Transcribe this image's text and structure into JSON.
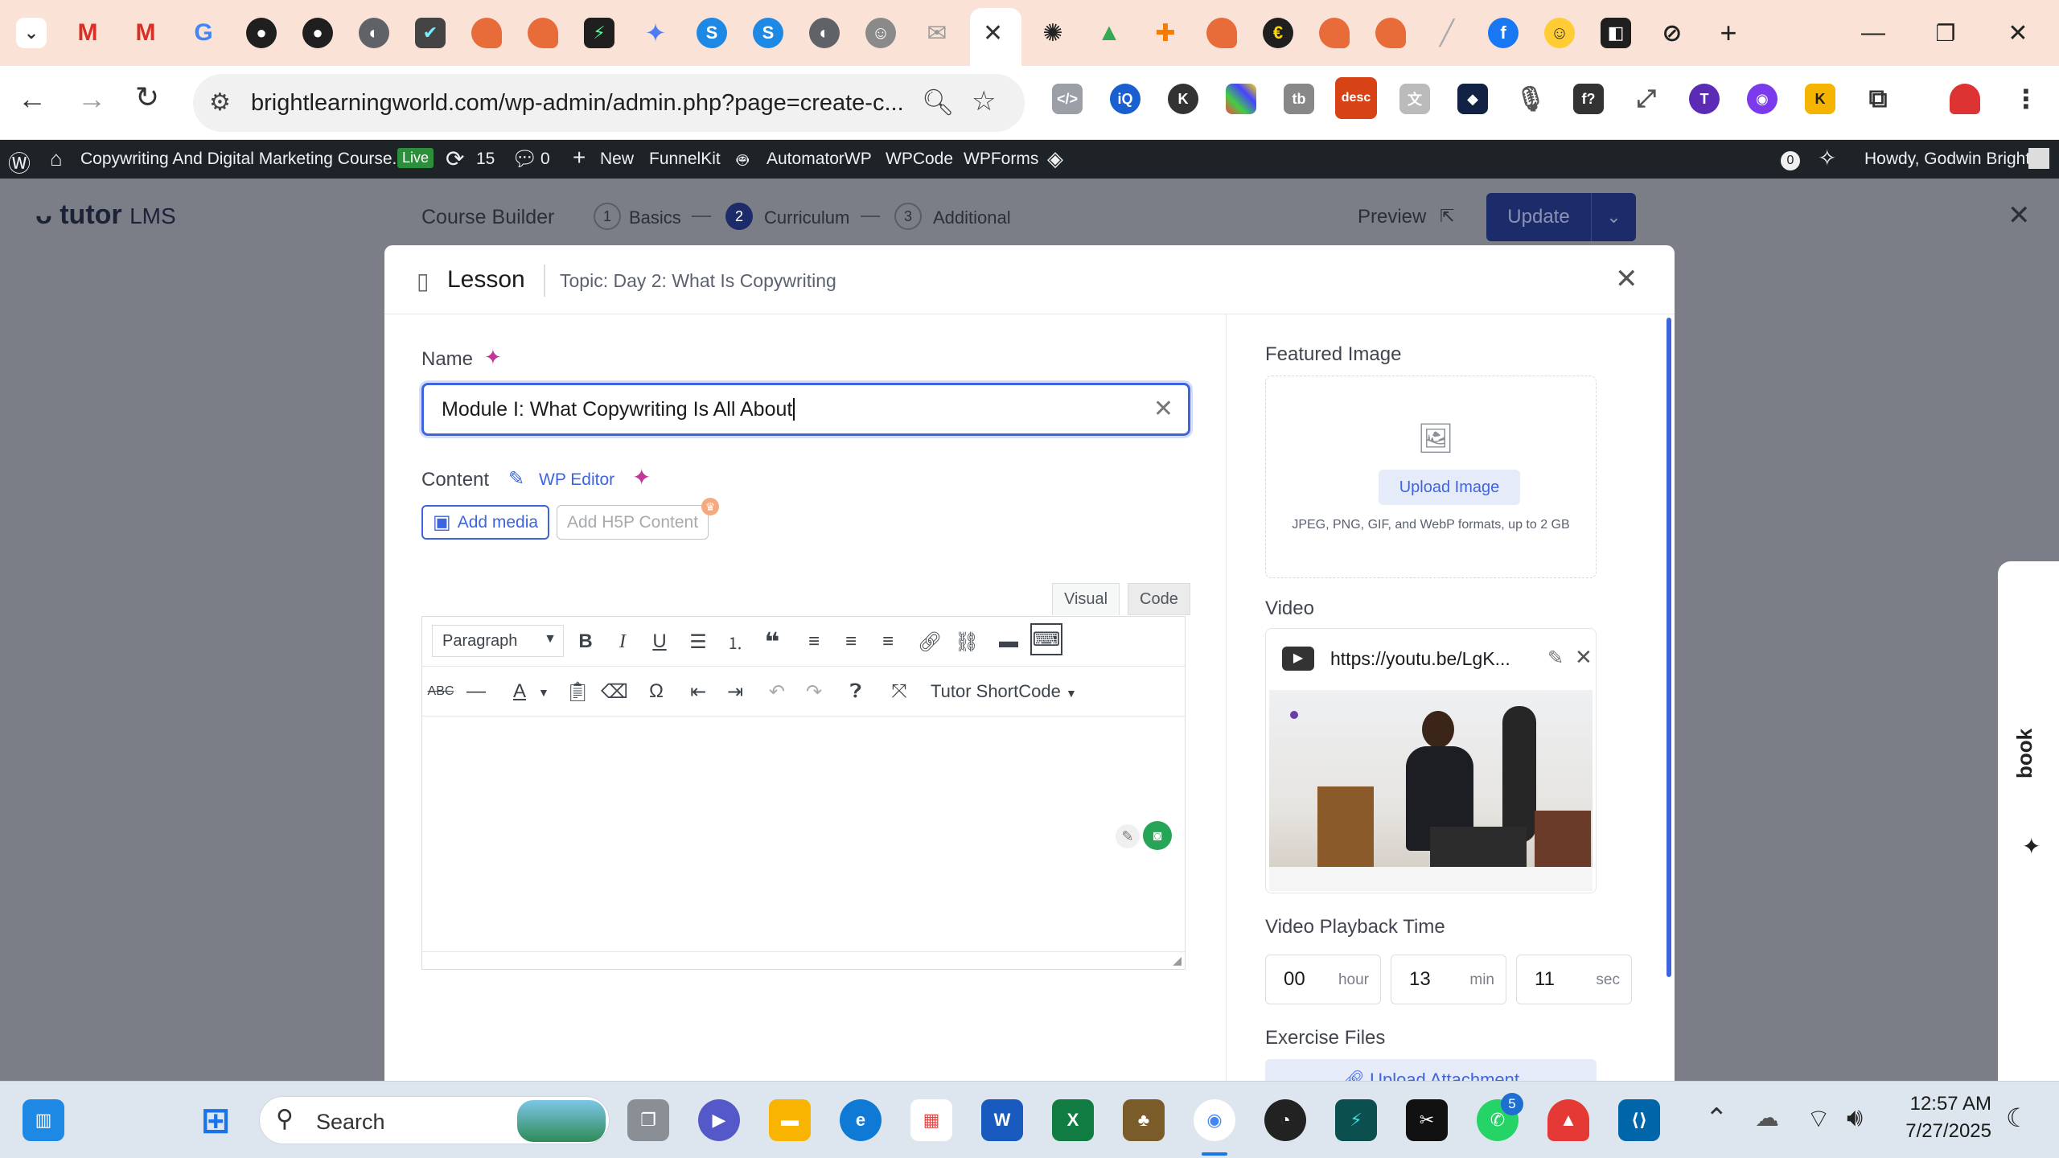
{
  "browser": {
    "url": "brightlearningworld.com/wp-admin/admin.php?page=create-c...",
    "tabs_count_hint": "many pinned tabs",
    "colors": {
      "tabstrip": "#fbe2d6",
      "accent": "#3e64de"
    }
  },
  "wp_admin_bar": {
    "site_name": "Copywriting And Digital Marketing Course...",
    "live_badge": "Live",
    "updates_count": "15",
    "comments_count": "0",
    "new_label": "New",
    "items": [
      "FunnelKit",
      "AutomatorWP",
      "WPCode",
      "WPForms"
    ],
    "notif_count": "0",
    "greeting": "Howdy, Godwin Bright"
  },
  "tutor_header": {
    "logo_text": "tutor",
    "logo_suffix": "LMS",
    "course_builder": "Course Builder",
    "steps": [
      {
        "num": "1",
        "label": "Basics"
      },
      {
        "num": "2",
        "label": "Curriculum"
      },
      {
        "num": "3",
        "label": "Additional"
      }
    ],
    "preview_label": "Preview",
    "update_label": "Update"
  },
  "modal": {
    "title": "Lesson",
    "topic": "Topic: Day 2: What Is Copywriting",
    "name_label": "Name",
    "name_value": "Module I: What Copywriting Is All About",
    "content_label": "Content",
    "wp_editor_label": "WP Editor",
    "add_media_label": "Add media",
    "add_h5p_label": "Add H5P Content",
    "visual_tab": "Visual",
    "code_tab": "Code",
    "format_select": "Paragraph",
    "shortcode_label": "Tutor ShortCode",
    "featured_image_label": "Featured Image",
    "upload_image_label": "Upload Image",
    "upload_hint": "JPEG, PNG, GIF, and WebP formats, up to 2 GB",
    "video_label": "Video",
    "video_url": "https://youtu.be/LgK...",
    "playback_label": "Video Playback Time",
    "playback": {
      "hour": "00",
      "hour_unit": "hour",
      "min": "13",
      "min_unit": "min",
      "sec": "11",
      "sec_unit": "sec"
    },
    "exercise_label": "Exercise Files",
    "upload_attachment_label": "Upload Attachment"
  },
  "side_panel": {
    "text": "book"
  },
  "taskbar": {
    "search_placeholder": "Search",
    "whatsapp_badge": "5",
    "time": "12:57 AM",
    "date": "7/27/2025"
  }
}
